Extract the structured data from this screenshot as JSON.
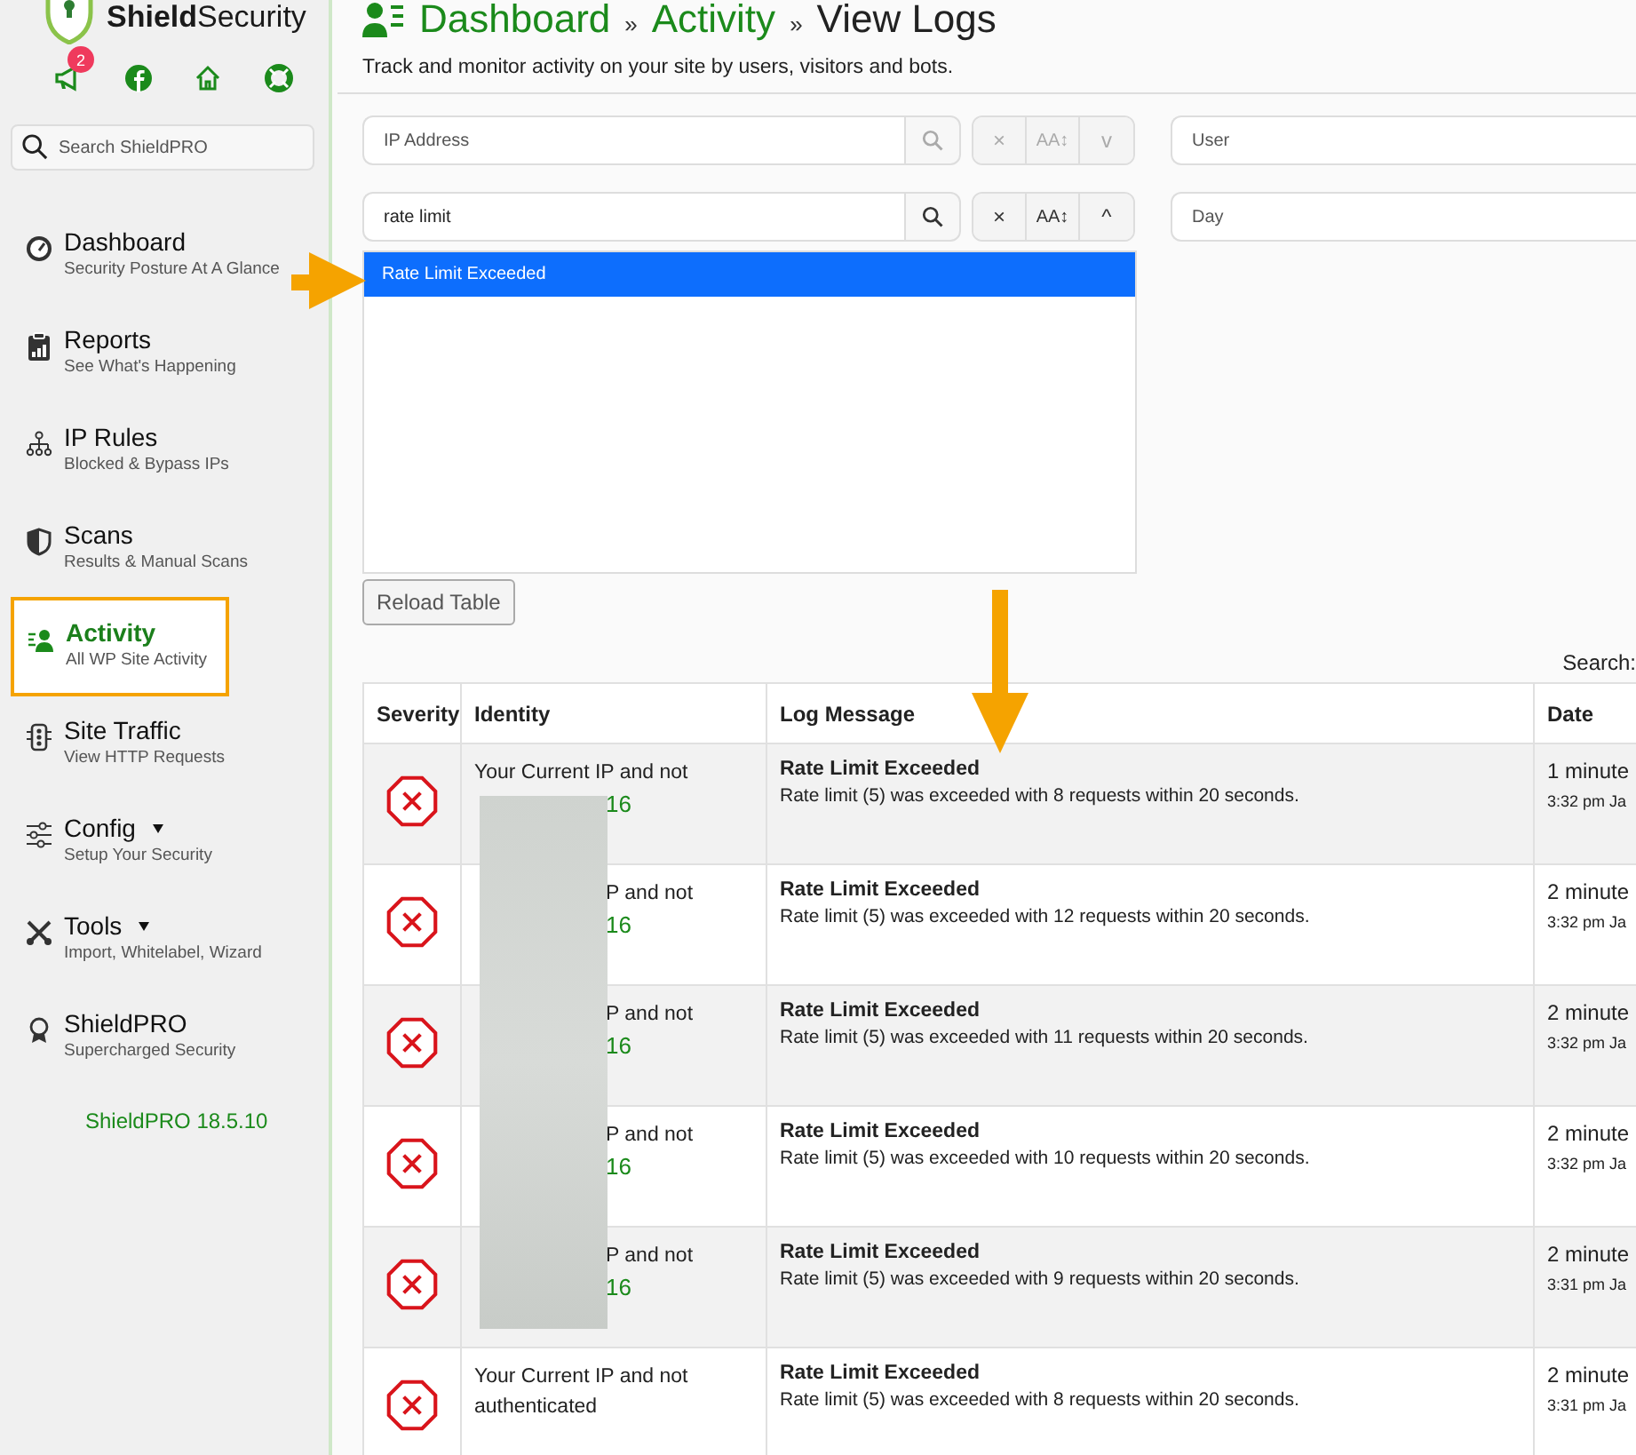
{
  "brand": {
    "name": "**Shield**Security"
  },
  "sidebar": {
    "notification_count": "2",
    "search_placeholder": "Search ShieldPRO",
    "items": [
      {
        "label": "Dashboard",
        "sublabel": "Security Posture At A Glance",
        "kind": "gauge",
        "selected": false,
        "has_caret": false
      },
      {
        "label": "Reports",
        "sublabel": "See What's Happening",
        "kind": "clipboard",
        "selected": false,
        "has_caret": false
      },
      {
        "label": "IP Rules",
        "sublabel": "Blocked & Bypass IPs",
        "kind": "network",
        "selected": false,
        "has_caret": false
      },
      {
        "label": "Scans",
        "sublabel": "Results & Manual Scans",
        "kind": "shield",
        "selected": false,
        "has_caret": false
      },
      {
        "label": "Activity",
        "sublabel": "All WP Site Activity",
        "kind": "person-list",
        "selected": true,
        "has_caret": false
      },
      {
        "label": "Site Traffic",
        "sublabel": "View HTTP Requests",
        "kind": "traffic",
        "selected": false,
        "has_caret": false
      },
      {
        "label": "Config",
        "sublabel": "Setup Your Security",
        "kind": "sliders",
        "selected": false,
        "has_caret": true
      },
      {
        "label": "Tools",
        "sublabel": "Import, Whitelabel, Wizard",
        "kind": "tools",
        "selected": false,
        "has_caret": true
      },
      {
        "label": "ShieldPRO",
        "sublabel": "Supercharged Security",
        "kind": "award",
        "selected": false,
        "has_caret": false
      }
    ],
    "version": "ShieldPRO 18.5.10"
  },
  "breadcrumb": {
    "separator": "»",
    "items": [
      {
        "label": "Dashboard",
        "kind": "link"
      },
      {
        "label": "Activity",
        "kind": "link"
      },
      {
        "label": "View Logs",
        "kind": "current"
      }
    ]
  },
  "subtitle": "Track and monitor activity on your site by users, visitors and bots.",
  "filters": [
    {
      "placeholder": "IP Address",
      "expanded": false,
      "clear": "×",
      "case": "AA↕",
      "toggle": "v"
    },
    {
      "value": "rate limit",
      "expanded": true,
      "clear": "×",
      "case": "AA↕",
      "toggle": "^"
    }
  ],
  "dropdown": {
    "options": [
      {
        "label": "Rate Limit Exceeded",
        "selected": true
      }
    ]
  },
  "right_filters": [
    {
      "placeholder": "User"
    },
    {
      "placeholder": "Day"
    }
  ],
  "reload_button": "Reload Table",
  "table_search_label": "Search:",
  "table": {
    "columns": [
      "Severity",
      "Identity",
      "Log Message",
      "Date"
    ],
    "rows": [
      {
        "kind": "error",
        "identity": [
          {
            "text": "Your Current IP and not",
            "covered": false
          },
          {
            "text": "16",
            "covered": true,
            "kind": "ip"
          }
        ],
        "title": "Rate Limit Exceeded",
        "message": "Rate limit (5) was exceeded with 8 requests within 20 seconds.",
        "when": "1 minute",
        "time": "3:32 pm Ja"
      },
      {
        "kind": "error",
        "identity": [
          {
            "text": "P and not",
            "covered": true
          },
          {
            "text": "16",
            "covered": true,
            "kind": "ip"
          }
        ],
        "title": "Rate Limit Exceeded",
        "message": "Rate limit (5) was exceeded with 12 requests within 20 seconds.",
        "when": "2 minute",
        "time": "3:32 pm Ja"
      },
      {
        "kind": "error",
        "identity": [
          {
            "text": "P and not",
            "covered": true
          },
          {
            "text": "16",
            "covered": true,
            "kind": "ip"
          }
        ],
        "title": "Rate Limit Exceeded",
        "message": "Rate limit (5) was exceeded with 11 requests within 20 seconds.",
        "when": "2 minute",
        "time": "3:32 pm Ja"
      },
      {
        "kind": "error",
        "identity": [
          {
            "text": "P and not",
            "covered": true
          },
          {
            "text": "16",
            "covered": true,
            "kind": "ip"
          }
        ],
        "title": "Rate Limit Exceeded",
        "message": "Rate limit (5) was exceeded with 10 requests within 20 seconds.",
        "when": "2 minute",
        "time": "3:32 pm Ja"
      },
      {
        "kind": "error",
        "identity": [
          {
            "text": "P and not",
            "covered": true
          },
          {
            "text": "16",
            "covered": true,
            "kind": "ip"
          }
        ],
        "title": "Rate Limit Exceeded",
        "message": "Rate limit (5) was exceeded with 9 requests within 20 seconds.",
        "when": "2 minute",
        "time": "3:31 pm Ja"
      },
      {
        "kind": "error",
        "identity": [
          {
            "text": "Your Current IP and not",
            "covered": false
          },
          {
            "text": "authenticated",
            "covered": false
          }
        ],
        "title": "Rate Limit Exceeded",
        "message": "Rate limit (5) was exceeded with 8 requests within 20 seconds.",
        "when": "2 minute",
        "time": "3:31 pm Ja"
      }
    ]
  }
}
